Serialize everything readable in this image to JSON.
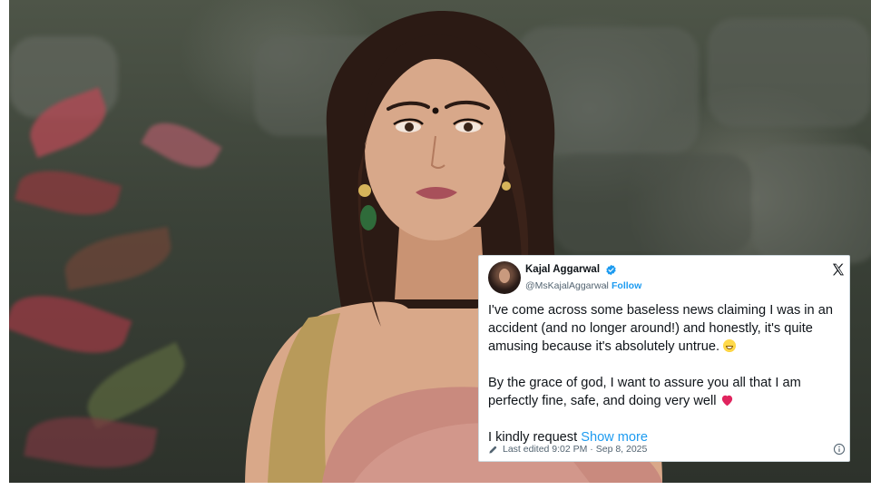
{
  "tweet": {
    "author_name": "Kajal Aggarwal",
    "author_handle": "@MsKajalAggarwal",
    "handle_separator": "·",
    "follow_label": "Follow",
    "paragraph_1": "I've come across some baseless news claiming I was in an accident (and no longer around!) and honestly, it's quite amusing because it's absolutely untrue.",
    "paragraph_2": "By the grace of god, I want to assure you all that I am perfectly fine, safe, and doing very well",
    "paragraph_3_prefix": "I kindly request",
    "show_more_label": "Show more",
    "edited_text": "Last edited 9:02 PM · Sep 8, 2025",
    "emoji_1": "grinning-face-emoji",
    "emoji_2": "red-heart-emoji",
    "icons": [
      "verified-badge-icon",
      "x-logo-icon",
      "edit-pencil-icon",
      "info-icon"
    ]
  },
  "colors": {
    "link_blue": "#1d9bf0",
    "text_primary": "#0f1419",
    "text_secondary": "#536471",
    "heart_red": "#e0245e",
    "card_border": "#cfd9de"
  }
}
